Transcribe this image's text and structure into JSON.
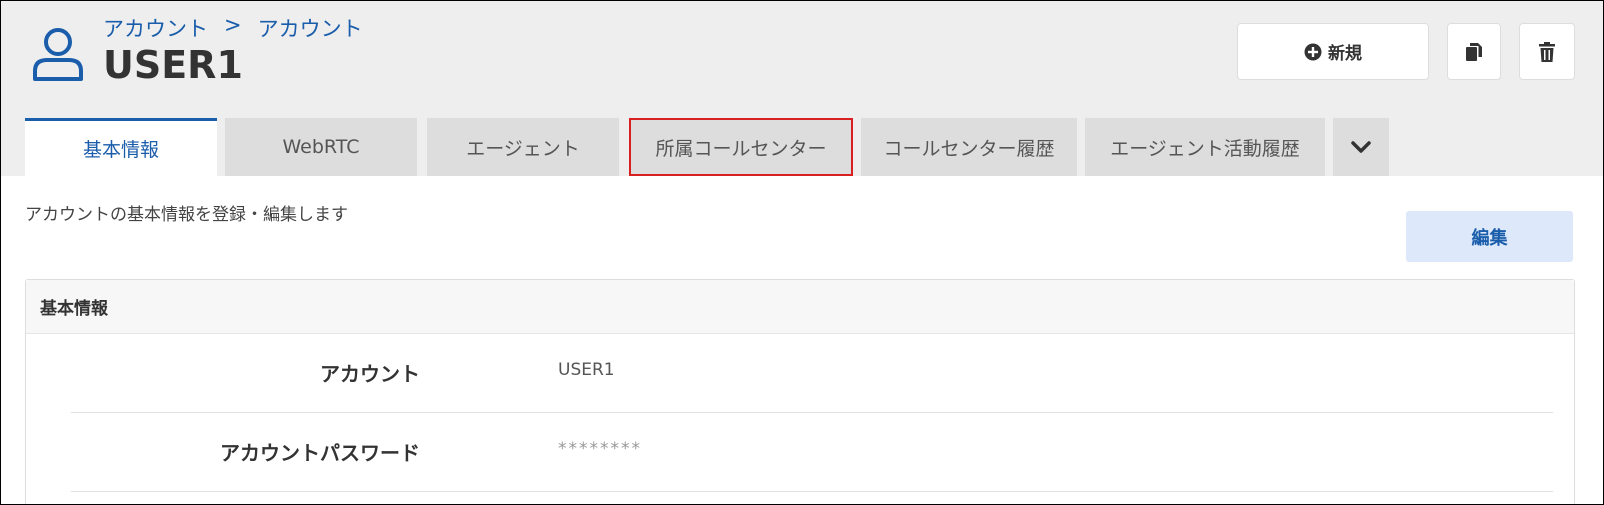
{
  "breadcrumb": {
    "parent": "アカウント",
    "separator": ">",
    "current": "アカウント"
  },
  "page": {
    "title": "USER1"
  },
  "toolbar": {
    "new_label": "新規"
  },
  "tabs": [
    {
      "label": "基本情報",
      "active": true
    },
    {
      "label": "WebRTC"
    },
    {
      "label": "エージェント"
    },
    {
      "label": "所属コールセンター",
      "highlighted": true
    },
    {
      "label": "コールセンター履歴"
    },
    {
      "label": "エージェント活動履歴"
    }
  ],
  "content": {
    "description": "アカウントの基本情報を登録・編集します",
    "edit_label": "編集",
    "panel": {
      "title": "基本情報",
      "rows": [
        {
          "label": "アカウント",
          "value": "USER1"
        },
        {
          "label": "アカウントパスワード",
          "value": "********"
        }
      ]
    }
  },
  "colors": {
    "accent": "#1a5dab",
    "highlight_border": "#d92020",
    "header_bg": "#eeeeee",
    "tab_bg": "#dddddd",
    "edit_bg": "#dde8fb"
  },
  "icons": {
    "user": "user-icon",
    "new": "plus-circle-icon",
    "copy": "copy-icon",
    "delete": "trash-icon",
    "more": "chevron-down-icon"
  }
}
